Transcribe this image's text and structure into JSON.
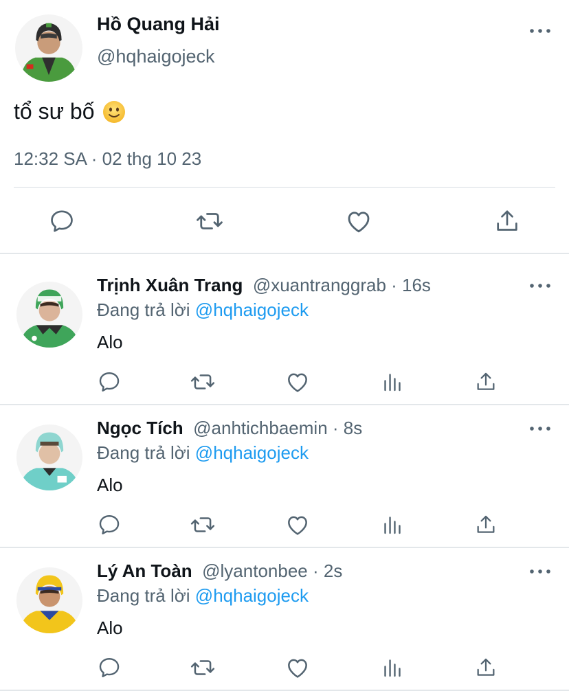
{
  "main_tweet": {
    "name": "Hồ Quang Hải",
    "handle": "@hqhaigojeck",
    "text": "tổ sư bố",
    "timestamp": "12:32 SA · 02 thg 10 23",
    "icons": [
      "reply-icon",
      "retweet-icon",
      "like-icon",
      "share-icon"
    ]
  },
  "replies": [
    {
      "name": "Trịnh Xuân Trang",
      "handle": "@xuantranggrab",
      "time": "16s",
      "replying_to_label": "Đang trả lời",
      "replying_to_handle": "@hqhaigojeck",
      "text": "Alo"
    },
    {
      "name": "Ngọc Tích",
      "handle": "@anhtichbaemin",
      "time": "8s",
      "replying_to_label": "Đang trả lời",
      "replying_to_handle": "@hqhaigojeck",
      "text": "Alo"
    },
    {
      "name": "Lý An Toàn",
      "handle": "@lyantonbee",
      "time": "2s",
      "replying_to_label": "Đang trả lời",
      "replying_to_handle": "@hqhaigojeck",
      "text": "Alo"
    }
  ],
  "colors": {
    "text_primary": "#0f1419",
    "text_secondary": "#536471",
    "link": "#1d9bf0",
    "gojek_green": "#4a9b3e",
    "grab_green": "#3fa55a",
    "baemin_teal": "#6fcfc8",
    "be_yellow": "#f2c51b"
  }
}
